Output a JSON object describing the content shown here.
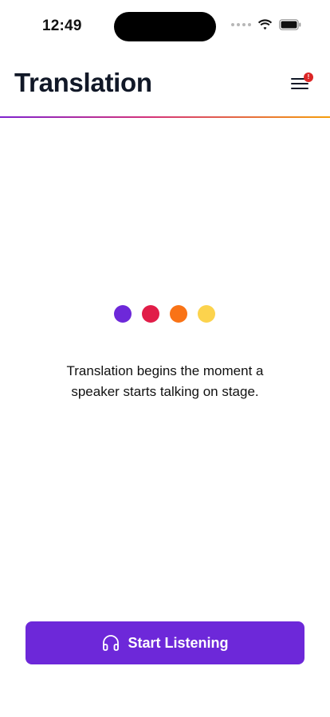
{
  "status_bar": {
    "time": "12:49"
  },
  "header": {
    "title": "Translation",
    "menu_badge": "!",
    "menu_icon": "hamburger-menu-icon"
  },
  "content": {
    "dot_colors": [
      "#6d28d9",
      "#e11d48",
      "#f97316",
      "#fcd34d"
    ],
    "message": "Translation begins the moment a speaker starts talking on stage."
  },
  "action": {
    "start_label": "Start Listening",
    "start_icon": "headphones-icon"
  },
  "colors": {
    "accent": "#6d28d9",
    "badge": "#dc2626"
  }
}
